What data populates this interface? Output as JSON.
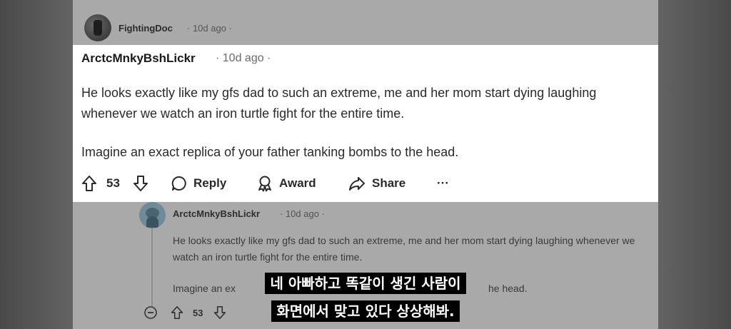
{
  "top_comment": {
    "username": "FightingDoc",
    "time": "· 10d ago ·"
  },
  "main_comment": {
    "username": "ArctcMnkyBshLickr",
    "time": "· 10d ago ·",
    "paragraphs": [
      "He looks exactly like my gfs dad to such an extreme, me and her mom start dying laughing whenever we watch an iron turtle fight for the entire time.",
      "Imagine an exact replica of your father tanking bombs to the head."
    ],
    "votes": "53",
    "reply_label": "Reply",
    "award_label": "Award",
    "share_label": "Share",
    "more_label": "···"
  },
  "reply_comment": {
    "username": "ArctcMnkyBshLickr",
    "time": "· 10d ago ·",
    "paragraphs": [
      "He looks exactly like my gfs dad to such an extreme, me and her mom start dying laughing whenever we watch an iron turtle fight for the entire time.",
      "Imagine an ex"
    ],
    "paragraph2_tail": "he head.",
    "votes": "53"
  },
  "subtitles": [
    "네 아빠하고 똑같이 생긴 사람이",
    "화면에서 맞고 있다 상상해봐."
  ],
  "colors": {
    "card": "#ffffff",
    "dimmed": "#a9a9a9",
    "subtitle_bg": "#000000",
    "subtitle_text": "#ffffff"
  }
}
